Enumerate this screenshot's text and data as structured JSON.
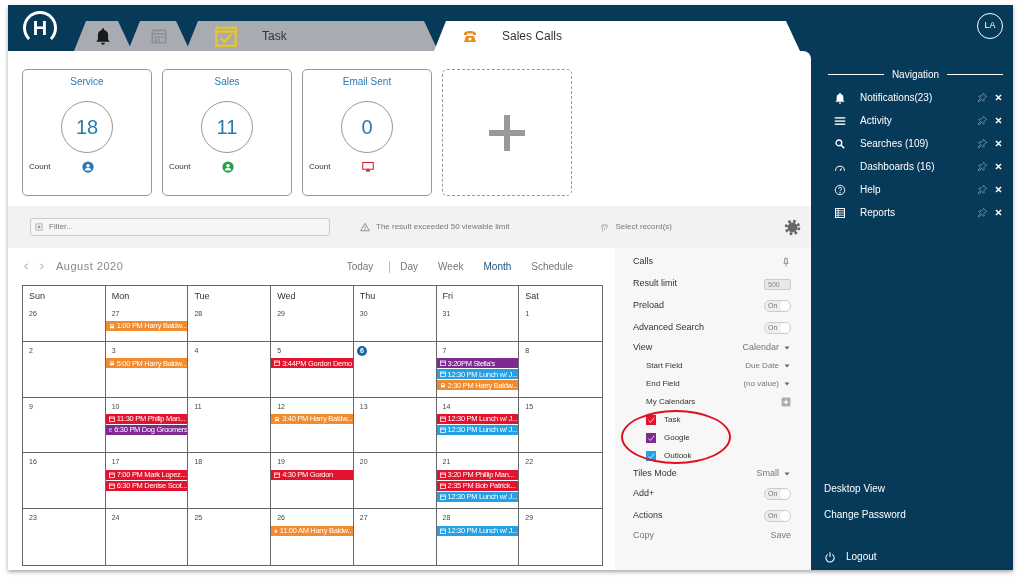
{
  "brand": {
    "logo_letter": "H"
  },
  "tabs": [
    {
      "selected": false
    },
    {
      "selected": false
    },
    {
      "label": "Task",
      "selected": false
    },
    {
      "label": "Sales Calls",
      "selected": true
    }
  ],
  "avatar": "LA",
  "tiles": [
    {
      "title": "Service",
      "value": "18",
      "footer": "Count"
    },
    {
      "title": "Sales",
      "value": "11",
      "footer": "Count"
    },
    {
      "title": "Email Sent",
      "value": "0",
      "footer": "Count"
    }
  ],
  "toolbar": {
    "filter_placeholder": "Filter...",
    "warning": "The result exceeded 50 viewable limit",
    "select_records": "Select record(s)"
  },
  "calendar": {
    "month": "August 2020",
    "views": [
      {
        "label": "Today",
        "selected": false
      },
      {
        "label": "Day",
        "selected": false
      },
      {
        "label": "Week",
        "selected": false
      },
      {
        "label": "Month",
        "selected": true
      },
      {
        "label": "Schedule",
        "selected": false
      }
    ],
    "weekdays": [
      "Sun",
      "Mon",
      "Tue",
      "Wed",
      "Thu",
      "Fri",
      "Sat"
    ],
    "weeks": [
      [
        {
          "day": "26",
          "today": false
        },
        {
          "day": "27",
          "today": false,
          "events": [
            {
              "kind": "call",
              "text": "1:00 PM Harry Baldw...",
              "color": "#f28a2e"
            }
          ]
        },
        {
          "day": "28",
          "today": false
        },
        {
          "day": "29",
          "today": false
        },
        {
          "day": "30",
          "today": false
        },
        {
          "day": "31",
          "today": false
        },
        {
          "day": "1",
          "today": false
        }
      ],
      [
        {
          "day": "2",
          "today": false
        },
        {
          "day": "3",
          "today": false,
          "events": [
            {
              "kind": "call",
              "text": "5:00 PM Harry Baldw...",
              "color": "#f28a2e"
            }
          ]
        },
        {
          "day": "4",
          "today": false
        },
        {
          "day": "5",
          "today": false,
          "events": [
            {
              "kind": "meeting",
              "text": "3:44PM Gordon Demo",
              "color": "#e3132d"
            }
          ]
        },
        {
          "day": "6",
          "today": true
        },
        {
          "day": "7",
          "today": false,
          "events": [
            {
              "kind": "meeting",
              "text": "3:20PM Stella's",
              "color": "#7d2a91"
            },
            {
              "kind": "meeting",
              "text": "12:30 PM Lunch w/ J...",
              "color": "#23a0e6"
            },
            {
              "kind": "call",
              "text": "2:30 PM Harry Baldw...",
              "color": "#f28a2e"
            }
          ]
        },
        {
          "day": "8",
          "today": false
        }
      ],
      [
        {
          "day": "9",
          "today": false
        },
        {
          "day": "10",
          "today": false,
          "events": [
            {
              "kind": "meeting",
              "text": "11:30 PM Philip Man...",
              "color": "#e3132d"
            },
            {
              "kind": "meeting",
              "text": "6:30 PM Dog Groomers",
              "color": "#7d2a91"
            }
          ]
        },
        {
          "day": "11",
          "today": false
        },
        {
          "day": "12",
          "today": false,
          "events": [
            {
              "kind": "call",
              "text": "3:40 PM Harry Baldw...",
              "color": "#f28a2e"
            }
          ]
        },
        {
          "day": "13",
          "today": false
        },
        {
          "day": "14",
          "today": false,
          "events": [
            {
              "kind": "meeting",
              "text": "12:30 PM Lunch w/ J...",
              "color": "#e3132d"
            },
            {
              "kind": "meeting",
              "text": "12:30 PM Lunch w/ J...",
              "color": "#23a0e6"
            }
          ]
        },
        {
          "day": "15",
          "today": false
        }
      ],
      [
        {
          "day": "16",
          "today": false
        },
        {
          "day": "17",
          "today": false,
          "events": [
            {
              "kind": "meeting",
              "text": "7:00 PM Mark Lopez...",
              "color": "#e3132d"
            },
            {
              "kind": "meeting",
              "text": "6:30 PM Denise Scot...",
              "color": "#e3132d"
            }
          ]
        },
        {
          "day": "18",
          "today": false
        },
        {
          "day": "19",
          "today": false,
          "events": [
            {
              "kind": "meeting",
              "text": "4:30 PM Gordon",
              "color": "#e3132d"
            }
          ]
        },
        {
          "day": "20",
          "today": false
        },
        {
          "day": "21",
          "today": false,
          "events": [
            {
              "kind": "meeting",
              "text": "3:20 PM Phillip Man...",
              "color": "#e3132d"
            },
            {
              "kind": "meeting",
              "text": "2:35 PM Bob Patrick...",
              "color": "#e3132d"
            },
            {
              "kind": "meeting",
              "text": "12:30 PM Lunch w/ J...",
              "color": "#23a0e6"
            }
          ]
        },
        {
          "day": "22",
          "today": false
        }
      ],
      [
        {
          "day": "23",
          "today": false
        },
        {
          "day": "24",
          "today": false
        },
        {
          "day": "25",
          "today": false
        },
        {
          "day": "26",
          "today": false,
          "events": [
            {
              "kind": "call",
              "text": "11:00 AM Harry Baldw...",
              "color": "#f28a2e"
            }
          ]
        },
        {
          "day": "27",
          "today": false
        },
        {
          "day": "28",
          "today": false,
          "events": [
            {
              "kind": "meeting",
              "text": "12:30 PM Lunch w/ J...",
              "color": "#23a0e6"
            }
          ]
        },
        {
          "day": "29",
          "today": false
        }
      ]
    ]
  },
  "settings": [
    {
      "kind": "pin",
      "label": "Calls"
    },
    {
      "kind": "number",
      "label": "Result limit",
      "value": "500"
    },
    {
      "kind": "toggle",
      "label": "Preload",
      "value": "On",
      "on": true
    },
    {
      "kind": "toggle",
      "label": "Advanced Search",
      "value": "On",
      "on": true
    },
    {
      "kind": "select",
      "label": "View",
      "value": "Calendar"
    },
    {
      "kind": "subselect",
      "label": "Start Field",
      "value": "Due Date"
    },
    {
      "kind": "subselect",
      "label": "End Field",
      "value": "(no value)"
    },
    {
      "kind": "add",
      "label": "My Calendars"
    },
    {
      "kind": "check",
      "label": "Task",
      "checked": true,
      "color": "#e3132d"
    },
    {
      "kind": "check",
      "label": "Google",
      "checked": true,
      "color": "#7d2a91"
    },
    {
      "kind": "check",
      "label": "Outlook",
      "checked": true,
      "color": "#23a0e6"
    },
    {
      "kind": "select",
      "label": "Tiles Mode",
      "value": "Small"
    },
    {
      "kind": "toggle",
      "label": "Add+",
      "value": "On",
      "on": true
    },
    {
      "kind": "toggle",
      "label": "Actions",
      "value": "On",
      "on": true
    },
    {
      "kind": "actions",
      "label": "Copy",
      "value": "Save"
    }
  ],
  "navigation": {
    "title": "Navigation",
    "items": [
      {
        "label": "Notifications(23)"
      },
      {
        "label": "Activity"
      },
      {
        "label": "Searches (109)"
      },
      {
        "label": "Dashboards (16)"
      },
      {
        "label": "Help"
      },
      {
        "label": "Reports"
      }
    ]
  },
  "links": [
    "Desktop View",
    "Change Password"
  ],
  "logout": "Logout"
}
